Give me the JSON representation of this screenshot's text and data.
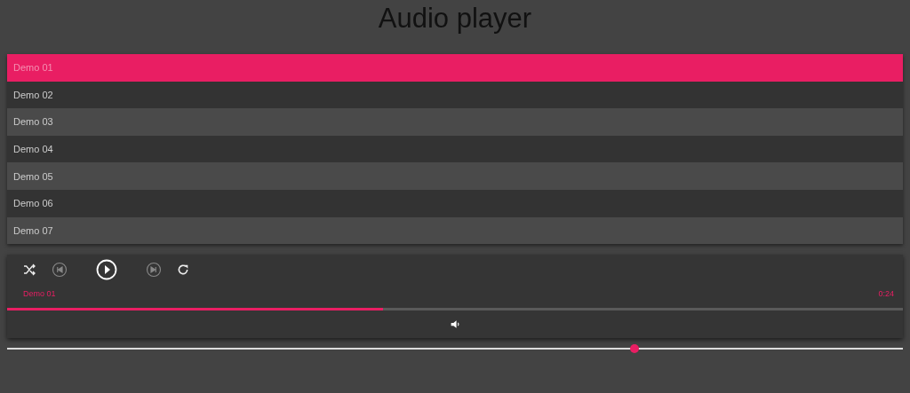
{
  "title": "Audio player",
  "playlist": [
    {
      "label": "Demo 01",
      "selected": true
    },
    {
      "label": "Demo 02",
      "selected": false
    },
    {
      "label": "Demo 03",
      "selected": false
    },
    {
      "label": "Demo 04",
      "selected": false
    },
    {
      "label": "Demo 05",
      "selected": false
    },
    {
      "label": "Demo 06",
      "selected": false
    },
    {
      "label": "Demo 07",
      "selected": false
    }
  ],
  "player": {
    "track": "Demo 01",
    "time": "0:24",
    "progress": {
      "level": 0.42
    },
    "volume": {
      "level": 0.7
    }
  }
}
